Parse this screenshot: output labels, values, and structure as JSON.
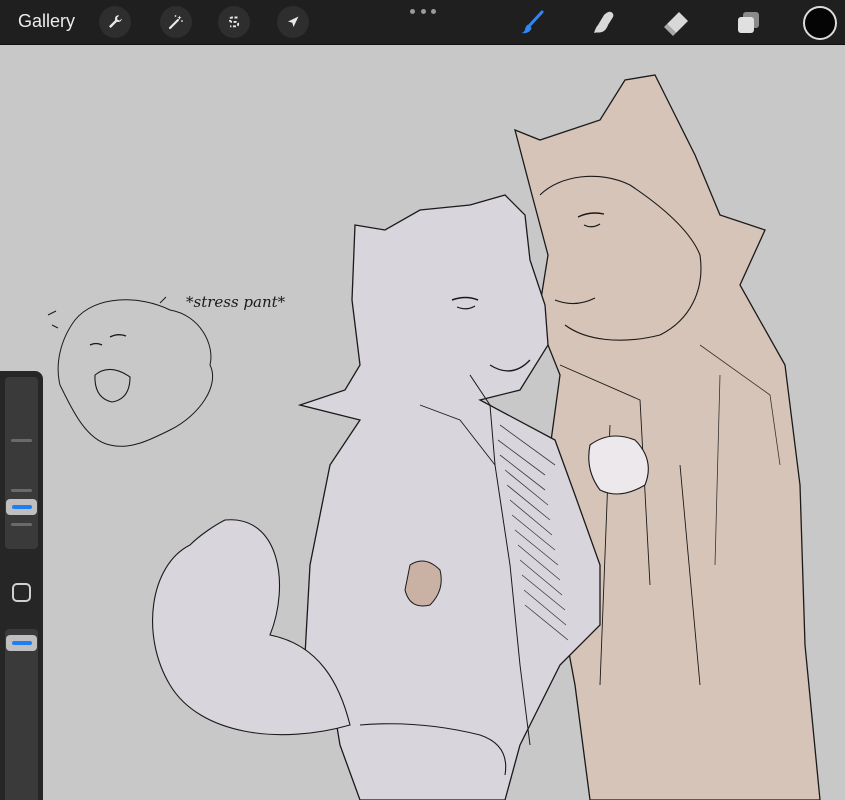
{
  "toolbar": {
    "gallery_label": "Gallery",
    "left_tools": [
      {
        "name": "actions",
        "icon": "wrench-icon"
      },
      {
        "name": "adjustments",
        "icon": "magic-wand-icon"
      },
      {
        "name": "selection",
        "icon": "selection-s-icon"
      },
      {
        "name": "transform",
        "icon": "arrow-cursor-icon"
      }
    ],
    "more_icon": "more-dots-icon",
    "right_tools": [
      {
        "name": "brush",
        "icon": "brush-icon",
        "active": true
      },
      {
        "name": "smudge",
        "icon": "smudge-finger-icon",
        "active": false
      },
      {
        "name": "eraser",
        "icon": "eraser-icon",
        "active": false
      },
      {
        "name": "layers",
        "icon": "layers-icon",
        "active": false
      }
    ],
    "current_color": "#050505"
  },
  "sidebar": {
    "brush_size_level": 0.35,
    "opacity_level": 1.0,
    "slider_thumb_color": "#1f7ff2",
    "modify_button_icon": "square-modify-icon"
  },
  "canvas": {
    "background_color": "#c8c8c8",
    "annotation_text": "*stress pant*",
    "fill_colors": {
      "left_character": "#d9d5dc",
      "right_character": "#d6c4b8",
      "line": "#1a1a1a"
    }
  },
  "colors": {
    "toolbar_bg": "#1f1f1f",
    "accent_blue": "#1f7ff2"
  }
}
